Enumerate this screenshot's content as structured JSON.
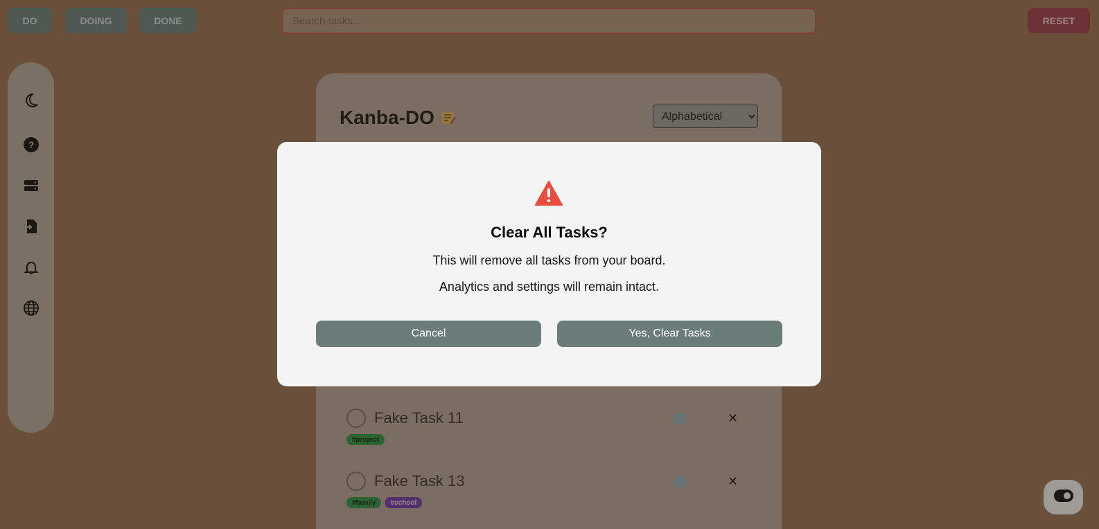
{
  "topbar": {
    "filters": [
      "DO",
      "DOING",
      "DONE"
    ],
    "search_placeholder": "Search tasks...",
    "reset_label": "RESET"
  },
  "siderail": {
    "icons": [
      "moon-icon",
      "help-icon",
      "storage-icon",
      "import-icon",
      "bell-icon",
      "globe-icon"
    ]
  },
  "board": {
    "title": "Kanba-DO",
    "title_emoji": "memo-icon",
    "sort_selected": "Alphabetical",
    "tasks": [
      {
        "name": "Fake Task 11",
        "tags": [
          "#project"
        ]
      },
      {
        "name": "Fake Task 13",
        "tags": [
          "#family",
          "#school"
        ]
      }
    ]
  },
  "modal": {
    "icon": "warning-icon",
    "title": "Clear All Tasks?",
    "line1": "This will remove all tasks from your board.",
    "line2": "Analytics and settings will remain intact.",
    "cancel_label": "Cancel",
    "confirm_label": "Yes, Clear Tasks"
  },
  "fab": {
    "icon": "toggle-icon"
  },
  "colors": {
    "background": "#a0785a",
    "filter_button": "#6e8a82",
    "reset_button": "#a3404e",
    "modal_button": "#6b7d78",
    "warning": "#e74c3c",
    "tag_green": "#2f9b4c",
    "tag_purple": "#7a3bb5"
  }
}
